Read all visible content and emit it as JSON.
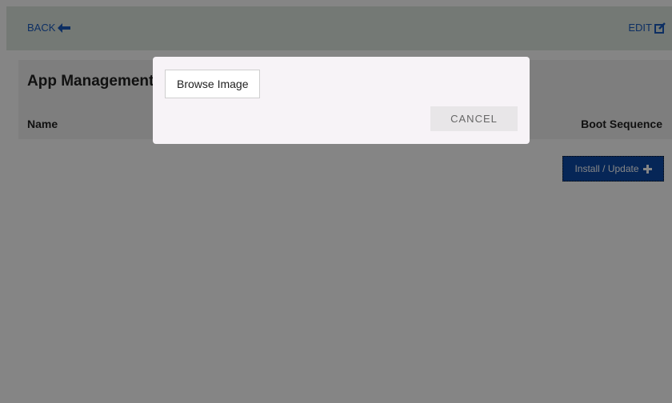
{
  "topbar": {
    "back_label": "BACK",
    "back_icon": "arrow-left-icon",
    "edit_label": "EDIT",
    "edit_icon": "edit-icon"
  },
  "panel": {
    "title": "App Management"
  },
  "table": {
    "columns": [
      "Name",
      "Boot Sequence"
    ]
  },
  "actions": {
    "install_label": "Install / Update",
    "install_icon": "plus-icon"
  },
  "modal": {
    "browse_label": "Browse Image",
    "cancel_label": "CANCEL"
  },
  "colors": {
    "link": "#1a5bbf",
    "topbar_bg": "#dfe8e1",
    "primary_button": "#0d4aa8",
    "overlay": "rgba(0,0,0,0.48)",
    "modal_bg": "#f7f3f7"
  }
}
